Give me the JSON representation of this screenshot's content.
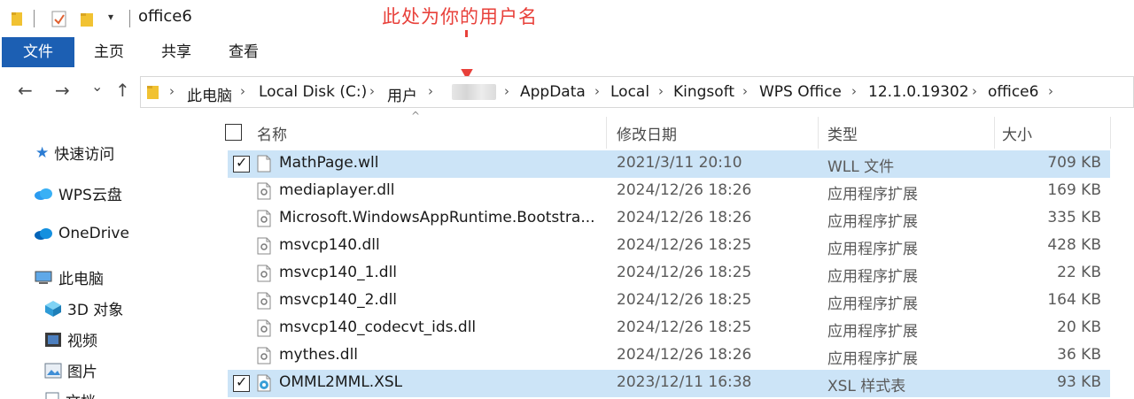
{
  "window": {
    "title": "office6",
    "annotation": "此处为你的用户名"
  },
  "ribbon": {
    "tabs": [
      {
        "label": "文件",
        "active": true
      },
      {
        "label": "主页",
        "active": false
      },
      {
        "label": "共享",
        "active": false
      },
      {
        "label": "查看",
        "active": false
      }
    ]
  },
  "nav": {
    "back": "←",
    "forward": "→",
    "recent": "⌄",
    "up": "↑"
  },
  "breadcrumb": [
    "此电脑",
    "Local Disk (C:)",
    "用户",
    "AppData",
    "Local",
    "Kingsoft",
    "WPS Office",
    "12.1.0.19302",
    "office6"
  ],
  "sidebar": {
    "items": [
      {
        "label": "快速访问",
        "icon": "star-icon"
      },
      {
        "label": "WPS云盘",
        "icon": "cloud-icon"
      },
      {
        "label": "OneDrive",
        "icon": "onedrive-icon"
      },
      {
        "label": "此电脑",
        "icon": "pc-icon"
      },
      {
        "label": "3D 对象",
        "icon": "cube-icon"
      },
      {
        "label": "视频",
        "icon": "video-icon"
      },
      {
        "label": "图片",
        "icon": "picture-icon"
      },
      {
        "label": "文档",
        "icon": "document-icon"
      }
    ]
  },
  "columns": {
    "name": "名称",
    "date": "修改日期",
    "type": "类型",
    "size": "大小"
  },
  "files": [
    {
      "name": "MathPage.wll",
      "date": "2021/3/11 20:10",
      "type": "WLL 文件",
      "size": "709 KB",
      "selected": true,
      "icon": "blank-file-icon"
    },
    {
      "name": "mediaplayer.dll",
      "date": "2024/12/26 18:26",
      "type": "应用程序扩展",
      "size": "169 KB",
      "selected": false,
      "icon": "dll-file-icon"
    },
    {
      "name": "Microsoft.WindowsAppRuntime.Bootstra...",
      "date": "2024/12/26 18:26",
      "type": "应用程序扩展",
      "size": "335 KB",
      "selected": false,
      "icon": "dll-file-icon"
    },
    {
      "name": "msvcp140.dll",
      "date": "2024/12/26 18:25",
      "type": "应用程序扩展",
      "size": "428 KB",
      "selected": false,
      "icon": "dll-file-icon"
    },
    {
      "name": "msvcp140_1.dll",
      "date": "2024/12/26 18:25",
      "type": "应用程序扩展",
      "size": "22 KB",
      "selected": false,
      "icon": "dll-file-icon"
    },
    {
      "name": "msvcp140_2.dll",
      "date": "2024/12/26 18:25",
      "type": "应用程序扩展",
      "size": "164 KB",
      "selected": false,
      "icon": "dll-file-icon"
    },
    {
      "name": "msvcp140_codecvt_ids.dll",
      "date": "2024/12/26 18:25",
      "type": "应用程序扩展",
      "size": "20 KB",
      "selected": false,
      "icon": "dll-file-icon"
    },
    {
      "name": "mythes.dll",
      "date": "2024/12/26 18:26",
      "type": "应用程序扩展",
      "size": "36 KB",
      "selected": false,
      "icon": "dll-file-icon"
    },
    {
      "name": "OMML2MML.XSL",
      "date": "2023/12/11 16:38",
      "type": "XSL 样式表",
      "size": "93 KB",
      "selected": true,
      "icon": "xsl-file-icon"
    }
  ],
  "colors": {
    "accent": "#1c5fb3",
    "selection": "#cce4f7",
    "annotation": "#e8403a"
  }
}
